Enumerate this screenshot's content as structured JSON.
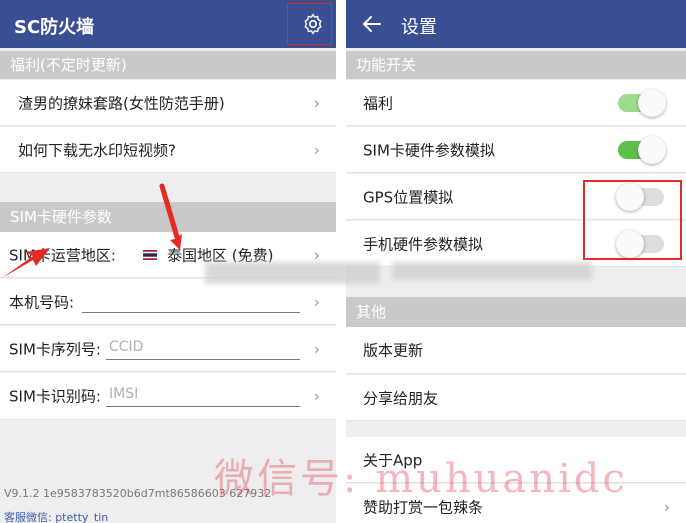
{
  "left": {
    "app_title": "SC防火墙",
    "section_welfare": "福利(不定时更新)",
    "welfare_items": [
      "渣男的撩妹套路(女性防范手册)",
      "如何下载无水印短视频?"
    ],
    "section_sim": "SIM卡硬件参数",
    "sim_region_label": "SIM卡运营地区:",
    "sim_region_value": "泰国地区 (免费)",
    "phone_number_label": "本机号码:",
    "sim_serial_label": "SIM卡序列号:",
    "sim_serial_placeholder": "CCID",
    "sim_id_label": "SIM卡识别码:",
    "sim_id_placeholder": "IMSI",
    "version_text": "V9.1.2   1e9583783520b6d7mt86586603 627932",
    "service_text": "客服微信: ptetty_tin"
  },
  "right": {
    "screen_title": "设置",
    "section_features": "功能开关",
    "toggles": [
      {
        "label": "福利",
        "state": "on"
      },
      {
        "label": "SIM卡硬件参数模拟",
        "state": "on"
      },
      {
        "label": "GPS位置模拟",
        "state": "off"
      },
      {
        "label": "手机硬件参数模拟",
        "state": "off"
      }
    ],
    "section_other": "其他",
    "other_items": [
      "版本更新",
      "分享给朋友"
    ],
    "about_items": [
      "关于App",
      "赞助打赏一包辣条"
    ]
  },
  "watermark": "微信号: muhuanidc",
  "colors": {
    "appbar": "#3a4f93",
    "toggle_on": "#5cc04a",
    "toggle_on_light": "#9ddc8f",
    "highlight": "#e12a2a"
  },
  "icons": {
    "settings": "gear-icon",
    "back": "back-arrow-icon",
    "chevron": "chevron-right-icon",
    "flag": "thailand-flag-icon"
  }
}
